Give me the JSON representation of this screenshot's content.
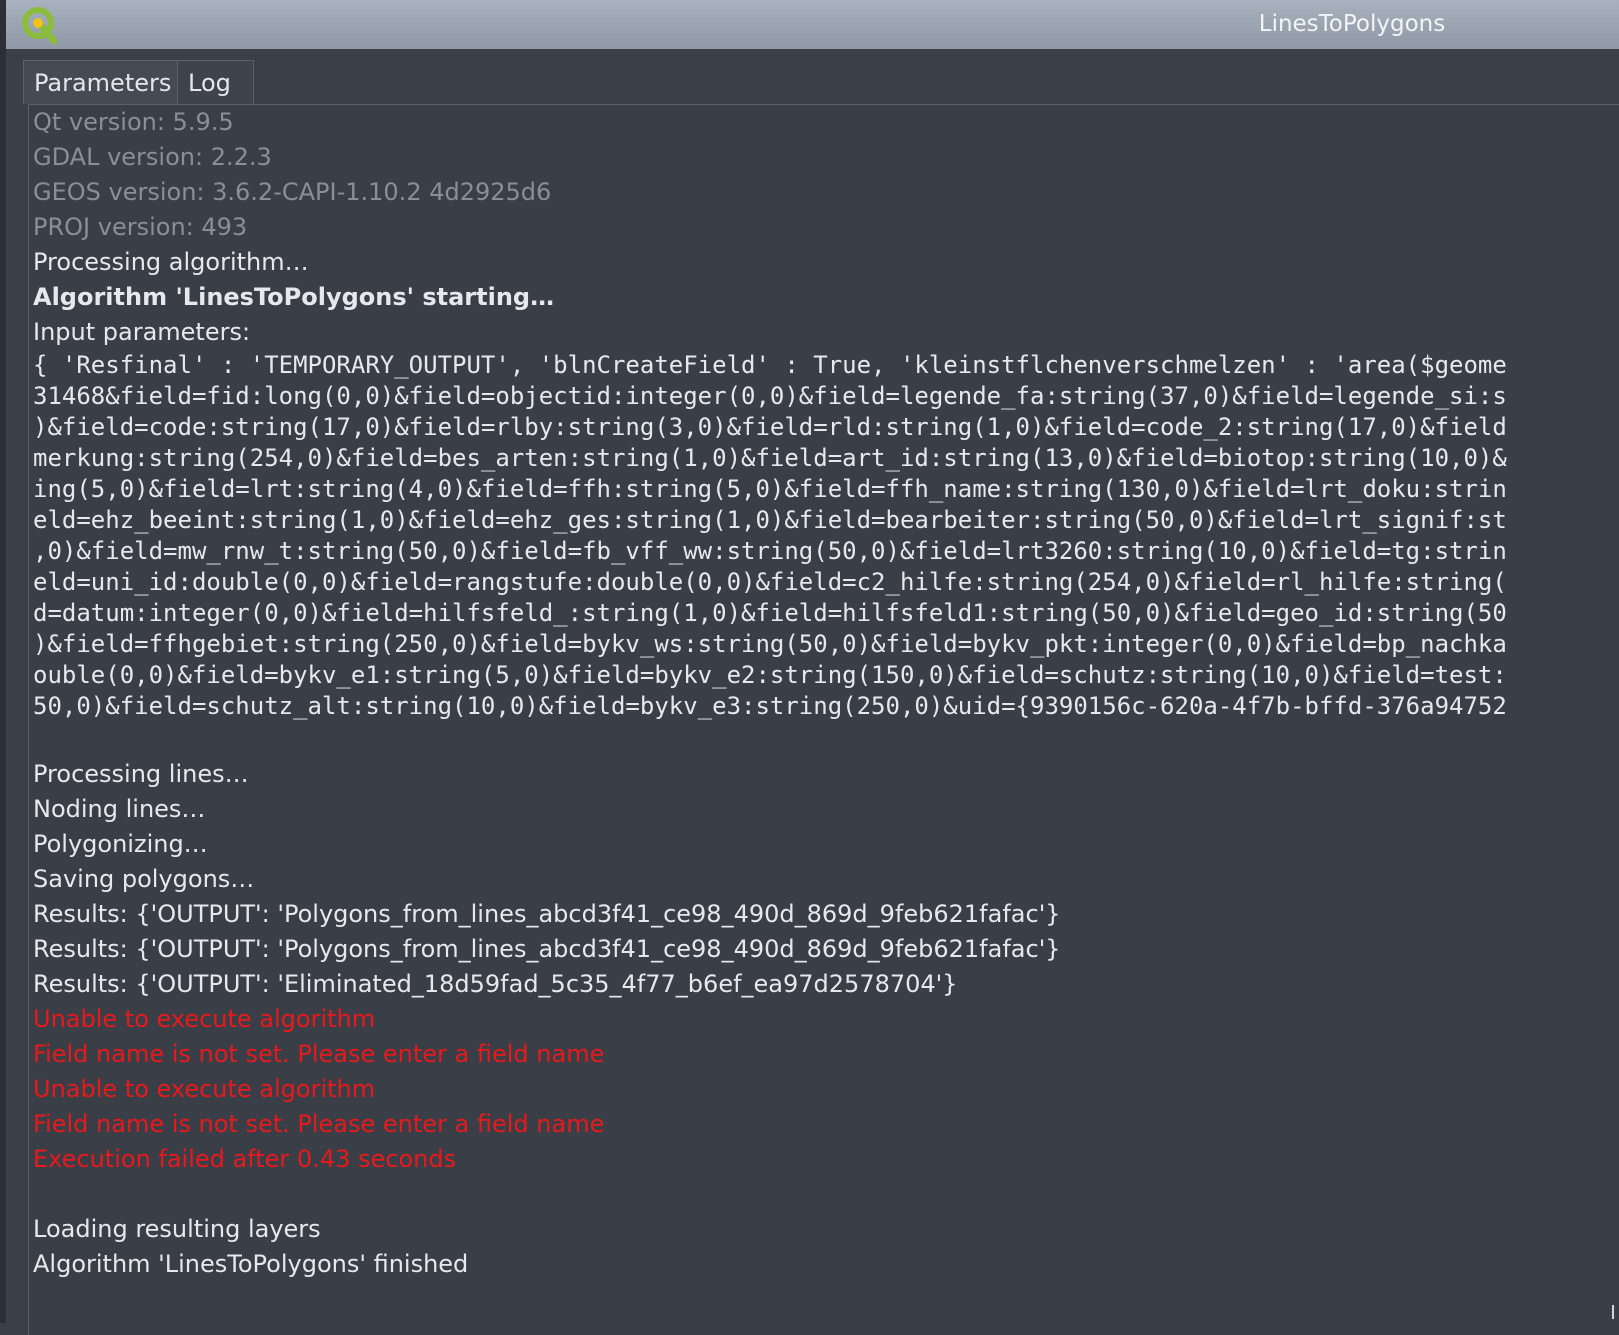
{
  "window": {
    "title": "LinesToPolygons",
    "logo_icon": "qgis-logo-icon"
  },
  "tabs": [
    {
      "label": "Parameters",
      "active": false
    },
    {
      "label": "Log",
      "active": true
    }
  ],
  "log": {
    "info_lines": [
      "Qt version: 5.9.5",
      "GDAL version: 2.2.3",
      "GEOS version: 3.6.2-CAPI-1.10.2 4d2925d6",
      "PROJ version: 493"
    ],
    "processing": "Processing algorithm…",
    "starting": "Algorithm 'LinesToPolygons' starting…",
    "input_header": "Input parameters:",
    "params": [
      "{ 'Resfinal' : 'TEMPORARY_OUTPUT', 'blnCreateField' : True, 'kleinstflchenverschmelzen' : 'area($geome",
      "31468&field=fid:long(0,0)&field=objectid:integer(0,0)&field=legende_fa:string(37,0)&field=legende_si:s",
      ")&field=code:string(17,0)&field=rlby:string(3,0)&field=rld:string(1,0)&field=code_2:string(17,0)&field",
      "merkung:string(254,0)&field=bes_arten:string(1,0)&field=art_id:string(13,0)&field=biotop:string(10,0)&",
      "ing(5,0)&field=lrt:string(4,0)&field=ffh:string(5,0)&field=ffh_name:string(130,0)&field=lrt_doku:strin",
      "eld=ehz_beeint:string(1,0)&field=ehz_ges:string(1,0)&field=bearbeiter:string(50,0)&field=lrt_signif:st",
      ",0)&field=mw_rnw_t:string(50,0)&field=fb_vff_ww:string(50,0)&field=lrt3260:string(10,0)&field=tg:strin",
      "eld=uni_id:double(0,0)&field=rangstufe:double(0,0)&field=c2_hilfe:string(254,0)&field=rl_hilfe:string(",
      "d=datum:integer(0,0)&field=hilfsfeld_:string(1,0)&field=hilfsfeld1:string(50,0)&field=geo_id:string(50",
      ")&field=ffhgebiet:string(250,0)&field=bykv_ws:string(50,0)&field=bykv_pkt:integer(0,0)&field=bp_nachka",
      "ouble(0,0)&field=bykv_e1:string(5,0)&field=bykv_e2:string(150,0)&field=schutz:string(10,0)&field=test:",
      "50,0)&field=schutz_alt:string(10,0)&field=bykv_e3:string(250,0)&uid={9390156c-620a-4f7b-bffd-376a94752"
    ],
    "steps": [
      "Processing lines…",
      "Noding lines…",
      "Polygonizing…",
      "Saving polygons…",
      "Results: {'OUTPUT': 'Polygons_from_lines_abcd3f41_ce98_490d_869d_9feb621fafac'}",
      "Results: {'OUTPUT': 'Polygons_from_lines_abcd3f41_ce98_490d_869d_9feb621fafac'}",
      "Results: {'OUTPUT': 'Eliminated_18d59fad_5c35_4f77_b6ef_ea97d2578704'}"
    ],
    "errors": [
      "Unable to execute algorithm",
      "Field name is not set. Please enter a field name",
      "Unable to execute algorithm",
      "Field name is not set. Please enter a field name",
      "Execution failed after 0.43 seconds"
    ],
    "final": [
      "Loading resulting layers",
      "Algorithm 'LinesToPolygons' finished"
    ]
  },
  "colors": {
    "background": "#3b3f47",
    "text": "#e6e8ec",
    "muted_text": "#8a8f97",
    "error_text": "#e8191c",
    "titlebar": "#9aa3b0"
  }
}
